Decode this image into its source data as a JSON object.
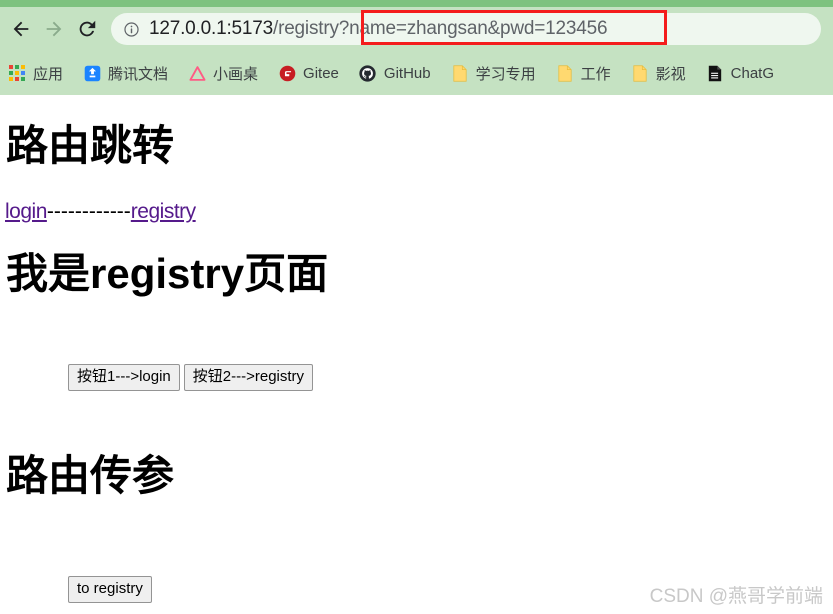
{
  "browser": {
    "nav": {
      "back_label": "Back",
      "forward_label": "Forward",
      "reload_label": "Reload"
    },
    "omnibox": {
      "site_info_icon": "info-circle-icon",
      "url_host": "127.0.0.1:5173",
      "url_path": "/registry",
      "url_query": "?name=zhangsan&pwd=123456",
      "full_url": "127.0.0.1:5173/registry?name=zhangsan&pwd=123456",
      "highlight_color": "#f41c1c"
    },
    "theme": {
      "tabstrip_color": "#7ec27f",
      "toolbar_color": "#c5e2c2",
      "omnibox_color": "#eff7ef"
    },
    "bookmarks": [
      {
        "label": "应用",
        "icon": "apps-grid-icon"
      },
      {
        "label": "腾讯文档",
        "icon": "tencent-docs-icon"
      },
      {
        "label": "小画桌",
        "icon": "xiaohuazhuo-triangle-icon"
      },
      {
        "label": "Gitee",
        "icon": "gitee-icon"
      },
      {
        "label": "GitHub",
        "icon": "github-icon"
      },
      {
        "label": "学习专用",
        "icon": "folder-icon"
      },
      {
        "label": "工作",
        "icon": "folder-icon"
      },
      {
        "label": "影视",
        "icon": "folder-icon"
      },
      {
        "label": "ChatG",
        "icon": "document-icon"
      }
    ]
  },
  "page": {
    "heading_routing": "路由跳转",
    "link_login": "login",
    "link_separator": "------------",
    "link_registry": "registry",
    "heading_page": "我是registry页面",
    "button_to_login": "按钮1--->login",
    "button_to_registry": "按钮2--->registry",
    "heading_params": "路由传参",
    "button_to_registry_params": "to registry",
    "watermark": "CSDN @燕哥学前端"
  }
}
